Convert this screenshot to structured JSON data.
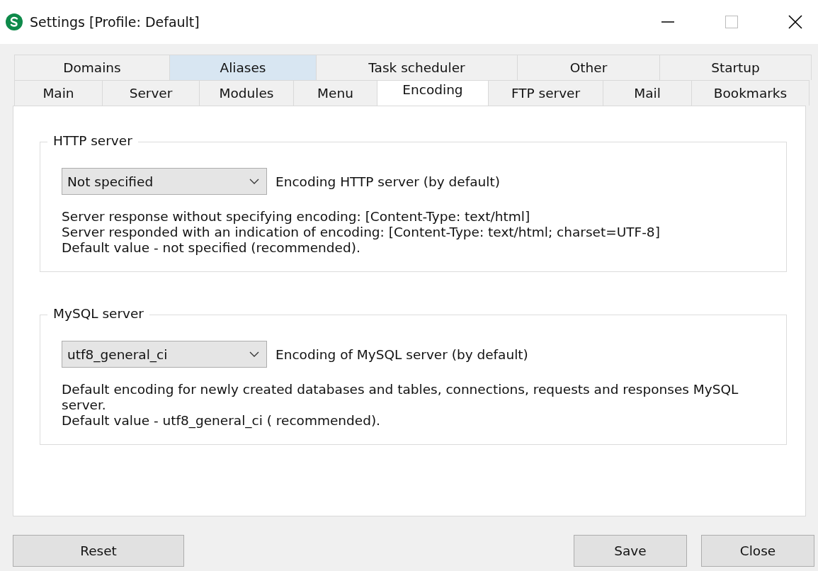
{
  "window": {
    "title": "Settings [Profile: Default]"
  },
  "tab_rows": [
    [
      {
        "label": "Domains",
        "selected": false,
        "hovered": false
      },
      {
        "label": "Aliases",
        "selected": false,
        "hovered": true
      },
      {
        "label": "Task scheduler",
        "selected": false,
        "hovered": false
      },
      {
        "label": "Other",
        "selected": false,
        "hovered": false
      },
      {
        "label": "Startup",
        "selected": false,
        "hovered": false
      }
    ],
    [
      {
        "label": "Main",
        "selected": false,
        "hovered": false
      },
      {
        "label": "Server",
        "selected": false,
        "hovered": false
      },
      {
        "label": "Modules",
        "selected": false,
        "hovered": false
      },
      {
        "label": "Menu",
        "selected": false,
        "hovered": false
      },
      {
        "label": "Encoding",
        "selected": true,
        "hovered": false
      },
      {
        "label": "FTP server",
        "selected": false,
        "hovered": false
      },
      {
        "label": "Mail",
        "selected": false,
        "hovered": false
      },
      {
        "label": "Bookmarks",
        "selected": false,
        "hovered": false
      }
    ]
  ],
  "groups": [
    {
      "title": "HTTP server",
      "dropdown": {
        "value": "Not specified"
      },
      "dropdown_label": "Encoding HTTP server (by default)",
      "lines": [
        "Server response without specifying encoding: [Content-Type: text/html]",
        "Server responded with an indication of encoding: [Content-Type: text/html; charset=UTF-8]",
        "Default value - not specified (recommended)."
      ]
    },
    {
      "title": "MySQL server",
      "dropdown": {
        "value": "utf8_general_ci"
      },
      "dropdown_label": "Encoding of MySQL server (by default)",
      "lines": [
        "Default encoding for newly created databases and tables, connections, requests and responses MySQL server.",
        "Default value - utf8_general_ci ( recommended)."
      ]
    }
  ],
  "buttons": {
    "left": [
      "Reset"
    ],
    "right": [
      "Save",
      "Close"
    ]
  }
}
